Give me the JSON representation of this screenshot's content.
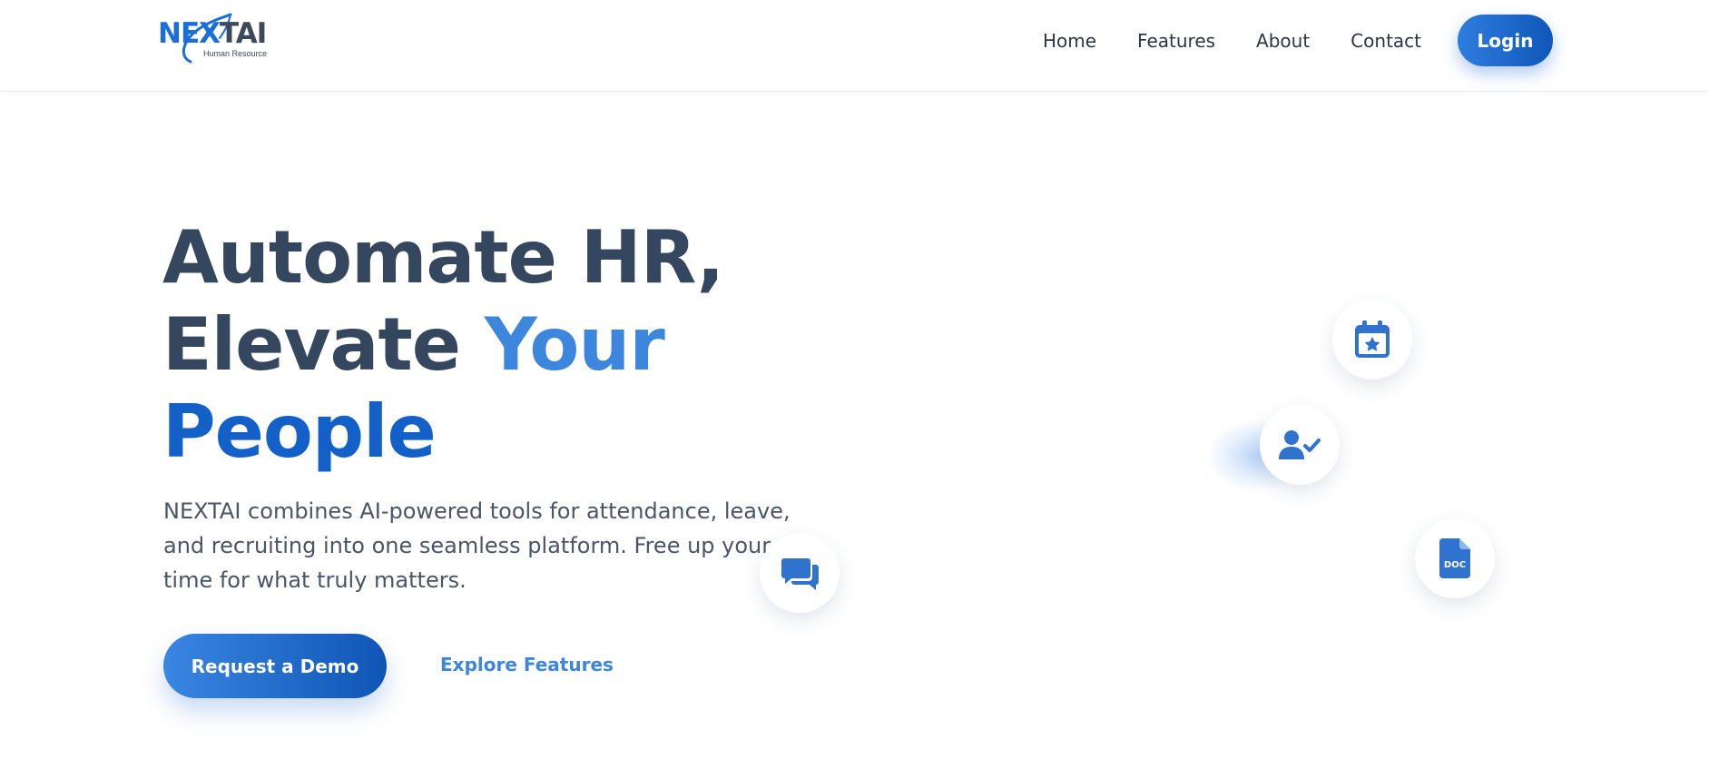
{
  "brand": {
    "logo_part_a": "NEX",
    "logo_part_b": "TAI",
    "logo_subtitle": "Human Resource"
  },
  "nav": {
    "items": [
      {
        "label": "Home"
      },
      {
        "label": "Features"
      },
      {
        "label": "About"
      },
      {
        "label": "Contact"
      }
    ],
    "login_label": "Login"
  },
  "hero": {
    "title_line1": "Automate HR,",
    "title_line2_a": "Elevate ",
    "title_line2_b": "Your",
    "title_line3": "People",
    "description": "NEXTAI combines AI-powered tools for attendance, leave, and recruiting into one seamless platform. Free up your time for what truly matters.",
    "primary_cta": "Request a Demo",
    "secondary_cta": "Explore Features"
  },
  "floating_icons": [
    "calendar-star-icon",
    "user-check-icon",
    "doc-file-icon",
    "chat-icon"
  ],
  "colors": {
    "accent": "#3d86dd",
    "accent_dark": "#1360c8",
    "heading": "#34475e",
    "body_text": "#4a5566"
  }
}
